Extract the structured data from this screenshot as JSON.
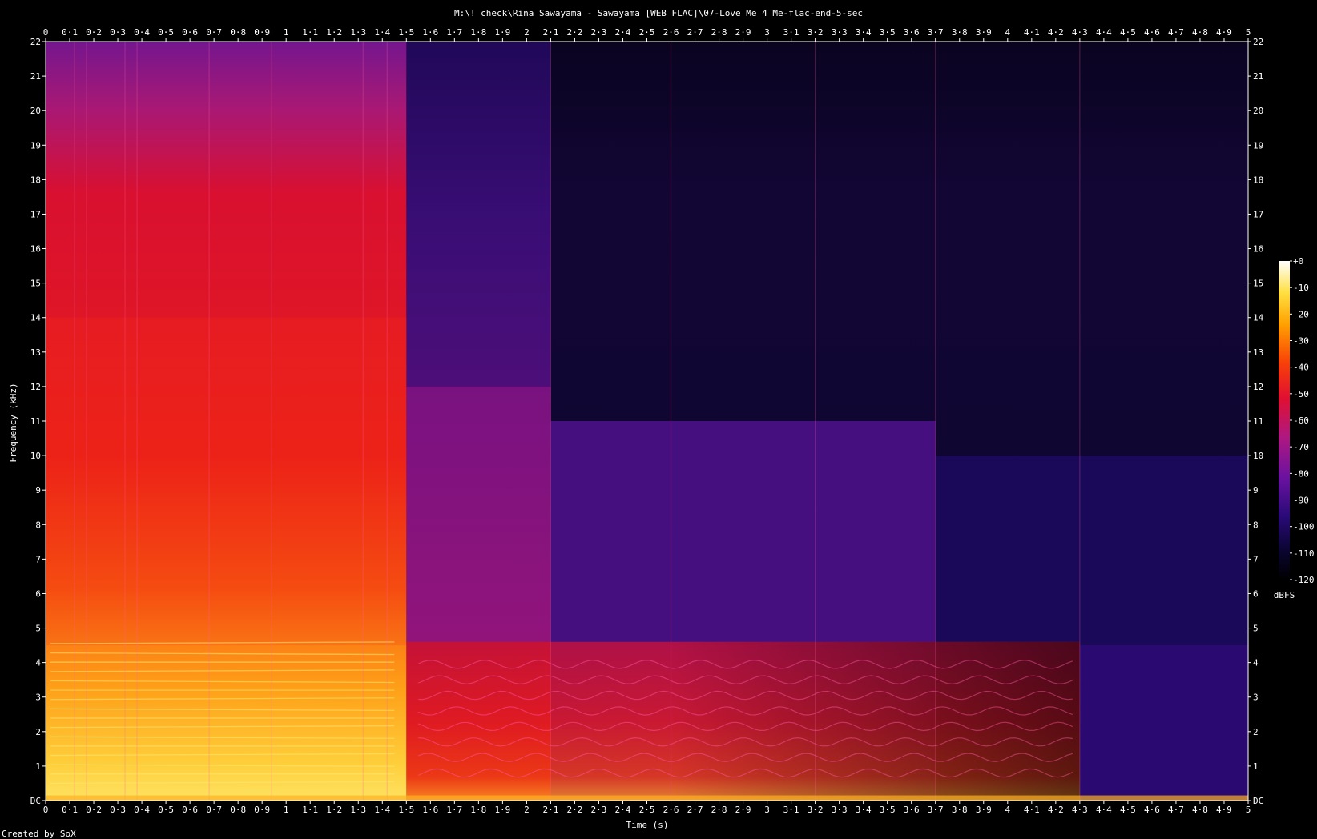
{
  "chart_data": {
    "type": "heatmap",
    "title": "M:\\! check\\Rina Sawayama - Sawayama [WEB FLAC]\\07-Love Me 4 Me-flac-end-5-sec",
    "xlabel": "Time (s)",
    "ylabel": "Frequency (kHz)",
    "footer": "Created by SoX",
    "xlim": [
      0,
      5
    ],
    "ylim": [
      0,
      22
    ],
    "x_ticks": [
      "0",
      "0·1",
      "0·2",
      "0·3",
      "0·4",
      "0·5",
      "0·6",
      "0·7",
      "0·8",
      "0·9",
      "1",
      "1·1",
      "1·2",
      "1·3",
      "1·4",
      "1·5",
      "1·6",
      "1·7",
      "1·8",
      "1·9",
      "2",
      "2·1",
      "2·2",
      "2·3",
      "2·4",
      "2·5",
      "2·6",
      "2·7",
      "2·8",
      "2·9",
      "3",
      "3·1",
      "3·2",
      "3·3",
      "3·4",
      "3·5",
      "3·6",
      "3·7",
      "3·8",
      "3·9",
      "4",
      "4·1",
      "4·2",
      "4·3",
      "4·4",
      "4·5",
      "4·6",
      "4·7",
      "4·8",
      "4·9",
      "5"
    ],
    "y_ticks": [
      "DC",
      "1",
      "2",
      "3",
      "4",
      "5",
      "6",
      "7",
      "8",
      "9",
      "10",
      "11",
      "12",
      "13",
      "14",
      "15",
      "16",
      "17",
      "18",
      "19",
      "20",
      "21",
      "22"
    ],
    "colorbar": {
      "label": "dBFS",
      "ticks": [
        "+0",
        "-10",
        "-20",
        "-30",
        "-40",
        "-50",
        "-60",
        "-70",
        "-80",
        "-90",
        "-100",
        "-110",
        "-120"
      ],
      "range": [
        -120,
        0
      ]
    },
    "grid": false,
    "legend": "none",
    "energy_regions": [
      {
        "t": [
          0,
          1.5
        ],
        "f": [
          0,
          22
        ],
        "level_dbfs": -60
      },
      {
        "t": [
          0,
          1.5
        ],
        "f": [
          0,
          14
        ],
        "level_dbfs": -45
      },
      {
        "t": [
          0,
          1.5
        ],
        "f": [
          0,
          4.5
        ],
        "level_dbfs": -25
      },
      {
        "t": [
          1.5,
          2.1
        ],
        "f": [
          0,
          12
        ],
        "level_dbfs": -65
      },
      {
        "t": [
          1.5,
          4.3
        ],
        "f": [
          0,
          4.6
        ],
        "level_dbfs": -55
      },
      {
        "t": [
          2.1,
          3.7
        ],
        "f": [
          0,
          11
        ],
        "level_dbfs": -88
      },
      {
        "t": [
          3.7,
          5
        ],
        "f": [
          0,
          10
        ],
        "level_dbfs": -100
      },
      {
        "t": [
          4.3,
          5
        ],
        "f": [
          0,
          4.5
        ],
        "level_dbfs": -95
      }
    ]
  }
}
